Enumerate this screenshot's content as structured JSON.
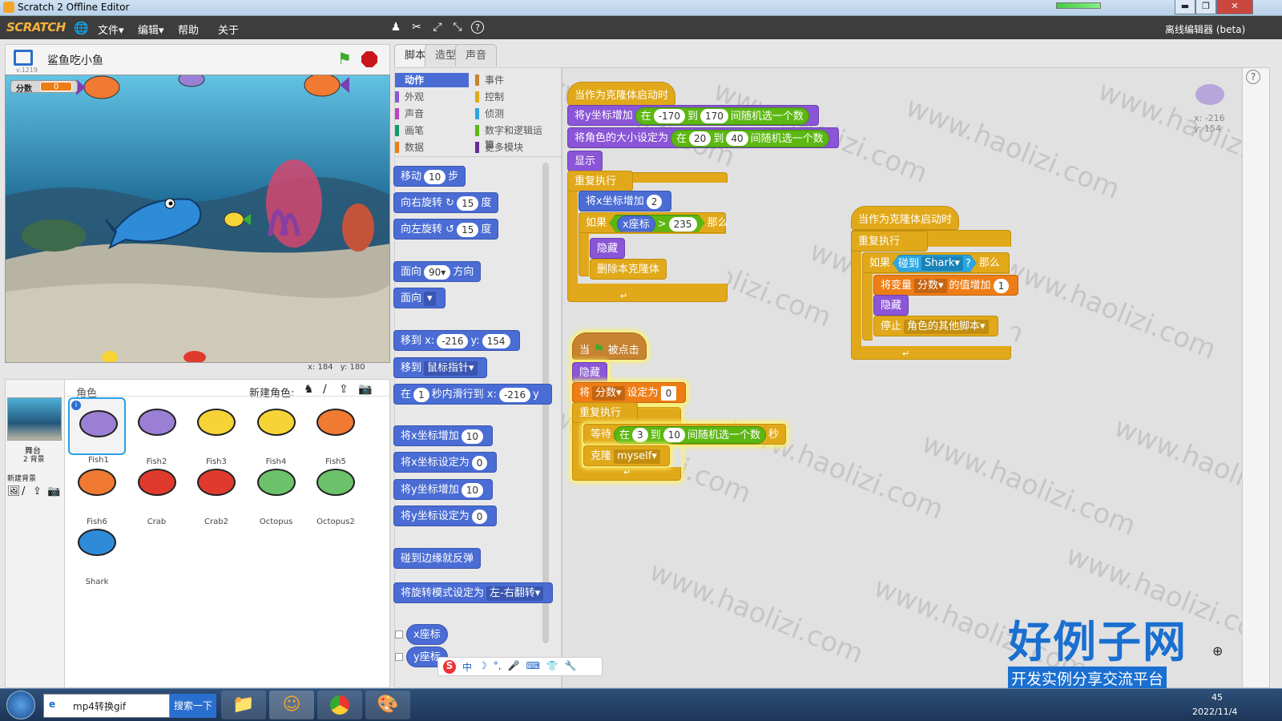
{
  "window": {
    "title": "Scratch 2 Offline Editor",
    "min": "▬",
    "max": "❐",
    "close": "✕"
  },
  "menubar": {
    "logo": "SCRATCH",
    "items": [
      "文件▾",
      "编辑▾",
      "帮助",
      "关于"
    ],
    "right_label": "离线编辑器 (beta)"
  },
  "stage": {
    "title": "鲨鱼吃小鱼",
    "version": "v.1219",
    "score_label": "分数",
    "score_value": "0",
    "mouse_x_label": "x:",
    "mouse_x": "184",
    "mouse_y_label": "y:",
    "mouse_y": "180"
  },
  "sprites": {
    "header": "角色",
    "new_sprite_label": "新建角色:",
    "stage_label": "舞台",
    "stage_backdrops": "2 背景",
    "new_backdrop_label": "新建背景",
    "items": [
      {
        "name": "Fish1",
        "color": "#9b7fd4"
      },
      {
        "name": "Fish2",
        "color": "#9b7fd4"
      },
      {
        "name": "Fish3",
        "color": "#f7d436"
      },
      {
        "name": "Fish4",
        "color": "#f7d436"
      },
      {
        "name": "Fish5",
        "color": "#f07a32"
      },
      {
        "name": "Fish6",
        "color": "#f07a32"
      },
      {
        "name": "Crab",
        "color": "#e03a2e"
      },
      {
        "name": "Crab2",
        "color": "#e03a2e"
      },
      {
        "name": "Octopus",
        "color": "#6cc26a"
      },
      {
        "name": "Octopus2",
        "color": "#6cc26a"
      },
      {
        "name": "Shark",
        "color": "#2e8bd8"
      }
    ]
  },
  "tabs": [
    "脚本",
    "造型",
    "声音"
  ],
  "categories": [
    {
      "label": "动作",
      "color": "#4a6cd4",
      "active": true
    },
    {
      "label": "事件",
      "color": "#c88330"
    },
    {
      "label": "外观",
      "color": "#8a55d7"
    },
    {
      "label": "控制",
      "color": "#e1a91a"
    },
    {
      "label": "声音",
      "color": "#bb42c3"
    },
    {
      "label": "侦测",
      "color": "#2ca5e2"
    },
    {
      "label": "画笔",
      "color": "#0e9a6c"
    },
    {
      "label": "数字和逻辑运算",
      "color": "#5cb712"
    },
    {
      "label": "数据",
      "color": "#ee7d16"
    },
    {
      "label": "更多模块",
      "color": "#632d99"
    }
  ],
  "palette": {
    "move": "移动",
    "move_val": "10",
    "steps": "步",
    "turn_right": "向右旋转",
    "turn_val": "15",
    "deg": "度",
    "turn_left": "向左旋转",
    "point_dir": "面向",
    "dir_val": "90▾",
    "dir_suffix": "方向",
    "point_towards": "面向",
    "towards_val": "▾",
    "goto": "移到 x:",
    "goto_x": "-216",
    "goto_y_label": "y:",
    "goto_y": "154",
    "goto_sprite": "移到",
    "goto_target": "鼠标指针▾",
    "glide": "在",
    "glide_secs": "1",
    "glide_mid": "秒内滑行到 x:",
    "glide_x": "-216",
    "glide_y": "y",
    "change_x": "将x坐标增加",
    "change_x_val": "10",
    "set_x": "将x坐标设定为",
    "set_x_val": "0",
    "change_y": "将y坐标增加",
    "change_y_val": "10",
    "set_y": "将y坐标设定为",
    "set_y_val": "0",
    "bounce": "碰到边缘就反弹",
    "rot_style": "将旋转模式设定为",
    "rot_val": "左-右翻转▾",
    "rep_x": "x座标",
    "rep_y": "y座标"
  },
  "script1": {
    "hat": "当作为克隆体启动时",
    "b1": "将y坐标增加",
    "b1_in": "在",
    "b1_a": "-170",
    "b1_to": "到",
    "b1_b": "170",
    "b1_tail": "间随机选一个数",
    "b2": "将角色的大小设定为",
    "b2_in": "在",
    "b2_a": "20",
    "b2_to": "到",
    "b2_b": "40",
    "b2_tail": "间随机选一个数",
    "b3": "显示",
    "loop": "重复执行",
    "b4": "将x坐标增加",
    "b4_val": "2",
    "if": "如果",
    "if_rep": "x座标",
    "if_op": ">",
    "if_val": "235",
    "then": "那么",
    "b5": "隐藏",
    "b6": "删除本克隆体",
    "loop_arrow": "↵"
  },
  "script2": {
    "hat_when": "当",
    "hat_tail": "被点击",
    "b1": "隐藏",
    "b2": "将",
    "b2_var": "分数▾",
    "b2_mid": "设定为",
    "b2_val": "0",
    "loop": "重复执行",
    "b3": "等待",
    "b3_in": "在",
    "b3_a": "3",
    "b3_to": "到",
    "b3_b": "10",
    "b3_tail": "间随机选一个数",
    "b3_secs": "秒",
    "b4": "克隆",
    "b4_val": "myself▾",
    "loop_arrow": "↵"
  },
  "script3": {
    "hat": "当作为克隆体启动时",
    "loop": "重复执行",
    "if": "如果",
    "touch": "碰到",
    "touch_val": "Shark▾",
    "q": "?",
    "then": "那么",
    "b1": "将变量",
    "b1_var": "分数▾",
    "b1_mid": "的值增加",
    "b1_val": "1",
    "b2": "隐藏",
    "b3": "停止",
    "b3_val": "角色的其他脚本▾",
    "loop_arrow": "↵"
  },
  "scripts_area": {
    "sprite_x": "x: -216",
    "sprite_y": "y: 154",
    "help": "?"
  },
  "watermark": {
    "line1": "好例子网",
    "line2": "开发实例分享交流平台",
    "tile": "www.haolizi.com"
  },
  "ime": {
    "items": [
      "S",
      "中",
      "☽",
      "°,",
      "🎤",
      "⌨",
      "👕",
      "🔧"
    ]
  },
  "taskbar": {
    "search_value": "mp4转换gif",
    "search_button": "搜索一下",
    "clock_time": "45",
    "clock_date": "2022/11/4"
  }
}
